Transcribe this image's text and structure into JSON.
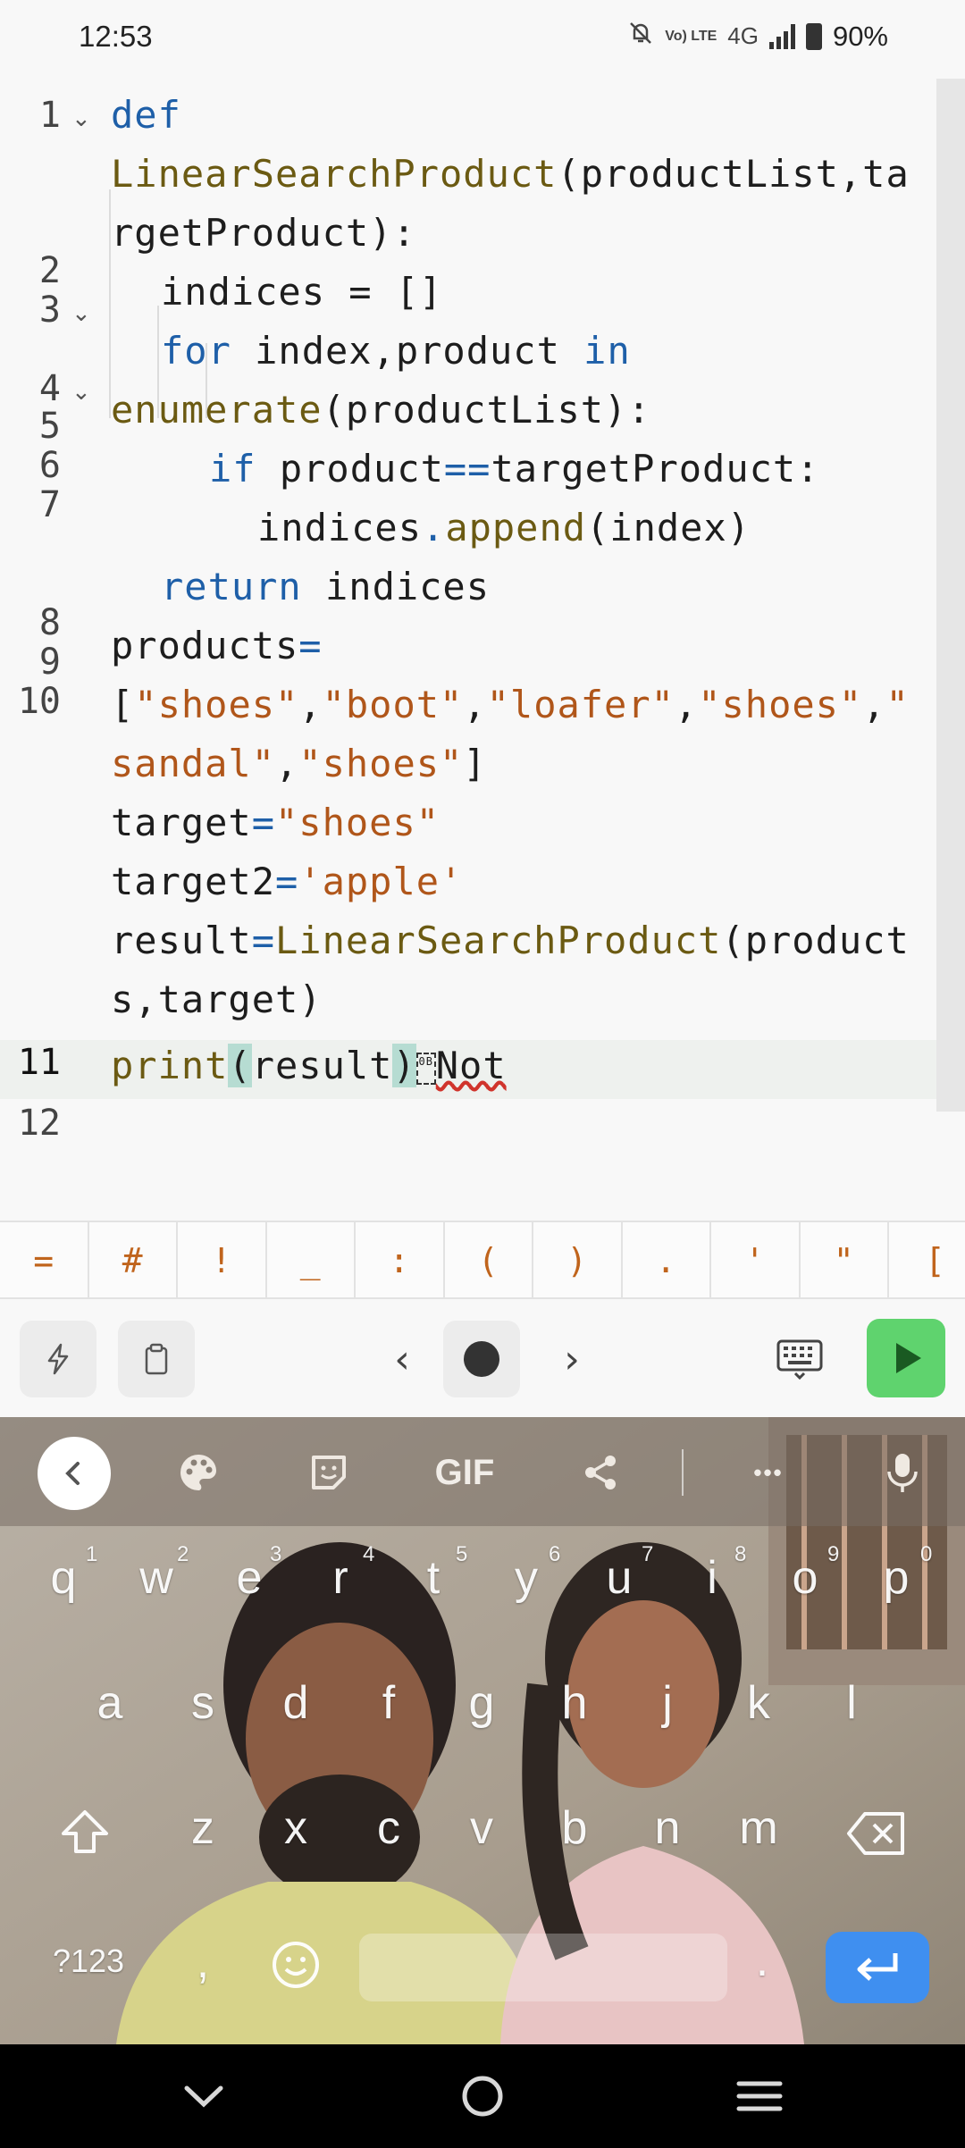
{
  "status_bar": {
    "time": "12:53",
    "network_label": "4G",
    "volte_label": "Vo) LTE",
    "battery": "90%"
  },
  "editor": {
    "lines": [
      {
        "n": "1",
        "fold": true
      },
      {
        "n": "2",
        "fold": false
      },
      {
        "n": "3",
        "fold": true
      },
      {
        "n": "4",
        "fold": true
      },
      {
        "n": "5",
        "fold": false
      },
      {
        "n": "6",
        "fold": false
      },
      {
        "n": "7",
        "fold": false
      },
      {
        "n": "8",
        "fold": false
      },
      {
        "n": "9",
        "fold": false
      },
      {
        "n": "10",
        "fold": false
      },
      {
        "n": "11",
        "fold": false
      },
      {
        "n": "12",
        "fold": false
      }
    ],
    "code": {
      "l1a": "def",
      "l1b_fn": "LinearSearchProduct",
      "l1b_rest": "(productList,ta",
      "l1c": "rgetProduct):",
      "l2": "indices = []",
      "l3_kw1": "for",
      "l3_mid": " index,product ",
      "l3_kw2": "in",
      "l3b_fn": "enumerate",
      "l3b_rest": "(productList):",
      "l4_kw": "if",
      "l4_a": " product",
      "l4_op": "==",
      "l4_b": "targetProduct:",
      "l5_a": "indices",
      "l5_dot": ".",
      "l5_fn": "append",
      "l5_b": "(index)",
      "l6_kw": "return",
      "l6_b": " indices",
      "l7a_a": "products",
      "l7a_op": "=",
      "l7b_open": "[",
      "l7b_s1": "\"shoes\"",
      "l7b_s2": "\"boot\"",
      "l7b_s3": "\"loafer\"",
      "l7b_s4": "\"shoes\"",
      "l7b_s5a": "\"",
      "l7c_s5b": "sandal\"",
      "l7c_s6": "\"shoes\"",
      "l7c_close": "]",
      "l8_a": "target",
      "l8_op": "=",
      "l8_s": "\"shoes\"",
      "l9_a": "target2",
      "l9_op": "=",
      "l9_s": "'apple'",
      "l10_a": "result",
      "l10_op": "=",
      "l10_fn": "LinearSearchProduct",
      "l10_b": "(product",
      "l10c": "s,target)",
      "l11_fn": "print",
      "l11_open": "(",
      "l11_mid": "result",
      "l11_close": ")",
      "l11_glyph": "0B",
      "l11_err": "Not"
    }
  },
  "symbol_row": [
    "=",
    "#",
    "!",
    "_",
    ":",
    "(",
    ")",
    ".",
    "'",
    "\"",
    "["
  ],
  "toolbar": {
    "prev": "‹",
    "next": "›"
  },
  "keyboard": {
    "gif_label": "GIF",
    "more_label": "•••",
    "row1": [
      "q",
      "w",
      "e",
      "r",
      "t",
      "y",
      "u",
      "i",
      "o",
      "p"
    ],
    "row1_hints": [
      "1",
      "2",
      "3",
      "4",
      "5",
      "6",
      "7",
      "8",
      "9",
      "0"
    ],
    "row2": [
      "a",
      "s",
      "d",
      "f",
      "g",
      "h",
      "j",
      "k",
      "l"
    ],
    "row3": [
      "z",
      "x",
      "c",
      "v",
      "b",
      "n",
      "m"
    ],
    "symbols_key": "?123",
    "comma_key": ",",
    "period_key": "."
  },
  "colors": {
    "keyword": "#1e5fa8",
    "function": "#6b5a12",
    "string": "#b0561a",
    "run_button": "#5fd36e",
    "enter_key": "#3f8ff0"
  },
  "icons": [
    "bell-muted-icon",
    "signal-icon",
    "battery-icon",
    "chevron-down-icon",
    "lightning-icon",
    "clipboard-icon",
    "keyboard-icon",
    "play-icon",
    "palette-icon",
    "sticker-icon",
    "share-icon",
    "microphone-icon",
    "shift-icon",
    "backspace-icon",
    "emoji-icon",
    "enter-icon"
  ]
}
